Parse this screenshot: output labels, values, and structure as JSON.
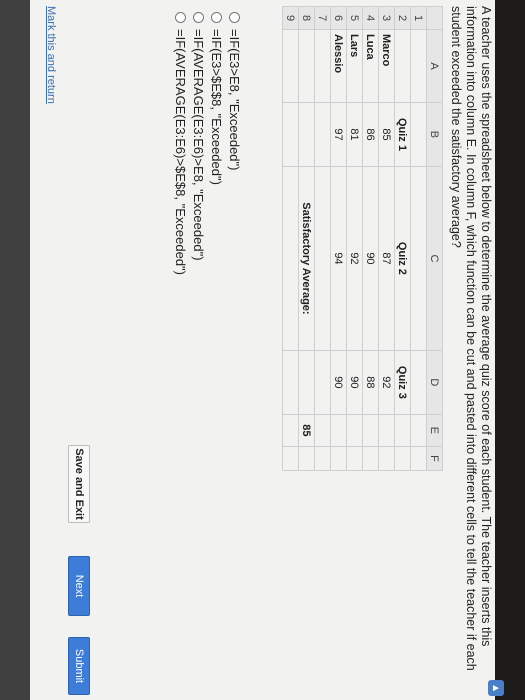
{
  "question": "A teacher uses the spreadsheet below to determine the average quiz score of each student. The teacher inserts this information into column E. In column F, which function can be cut and pasted into different cells to tell the teacher if each student exceeded the satisfactory average?",
  "sheet": {
    "columns": [
      "A",
      "B",
      "C",
      "D",
      "E",
      "F"
    ],
    "rows": [
      {
        "n": "1",
        "cells": [
          "",
          "",
          "",
          "",
          "",
          ""
        ]
      },
      {
        "n": "2",
        "cells": [
          "",
          "Quiz 1",
          "Quiz 2",
          "Quiz 3",
          "",
          ""
        ]
      },
      {
        "n": "3",
        "cells": [
          "Marco",
          "85",
          "87",
          "92",
          "",
          ""
        ]
      },
      {
        "n": "4",
        "cells": [
          "Luca",
          "86",
          "90",
          "88",
          "",
          ""
        ]
      },
      {
        "n": "5",
        "cells": [
          "Lars",
          "81",
          "92",
          "90",
          "",
          ""
        ]
      },
      {
        "n": "6",
        "cells": [
          "Alessio",
          "97",
          "94",
          "90",
          "",
          ""
        ]
      },
      {
        "n": "7",
        "cells": [
          "",
          "",
          "",
          "",
          "",
          ""
        ]
      },
      {
        "n": "8",
        "cells": [
          "",
          "",
          "Satisfactory Average:",
          "",
          "85",
          ""
        ]
      },
      {
        "n": "9",
        "cells": [
          "",
          "",
          "",
          "",
          "",
          ""
        ]
      }
    ]
  },
  "options": [
    "=IF(E3>E8, \"Exceeded\")",
    "=IF(E3>$E$8, \"Exceeded\")",
    "=IF(AVERAGE(E3:E6)>E8, \"Exceeded\")",
    "=IF(AVERAGE(E3:E6)>$E$8, \"Exceeded\")"
  ],
  "links": {
    "mark": "Mark this and return"
  },
  "buttons": {
    "save": "Save and Exit",
    "next": "Next",
    "submit": "Submit"
  },
  "colors": {
    "accent": "#3d7dd8",
    "link": "#3a6fb0"
  }
}
